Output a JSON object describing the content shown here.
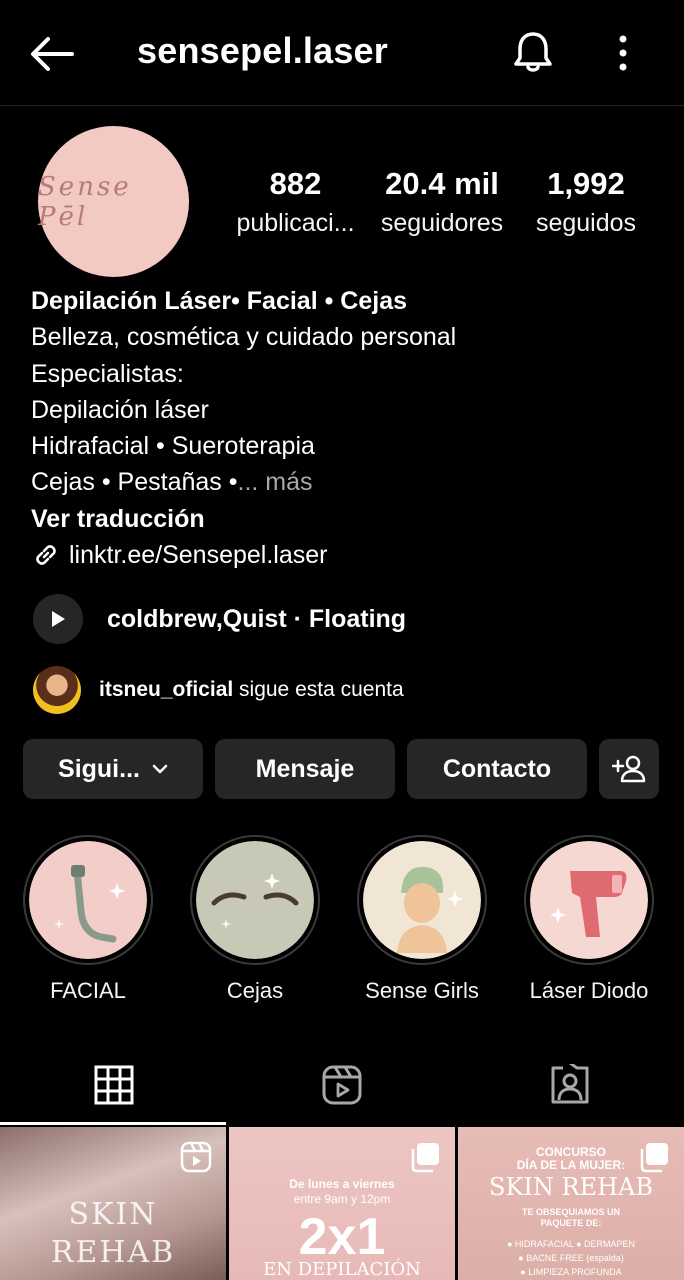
{
  "header": {
    "username": "sensepel.laser"
  },
  "profile": {
    "avatar_text": "Sense Pēl",
    "stats": [
      {
        "value": "882",
        "label": "publicaci..."
      },
      {
        "value": "20.4 mil",
        "label": "seguidores"
      },
      {
        "value": "1,992",
        "label": "seguidos"
      }
    ]
  },
  "bio": {
    "name": "Depilación Láser• Facial • Cejas",
    "category": "Belleza, cosmética y cuidado personal",
    "line1": "Especialistas:",
    "line2": "Depilación láser",
    "line3": "Hidrafacial • Sueroterapia",
    "line4": "Cejas • Pestañas •",
    "more": "... más",
    "translate": "Ver traducción",
    "link": "linktr.ee/Sensepel.laser"
  },
  "music": {
    "track": "coldbrew,Quist · Floating"
  },
  "followed_by": {
    "user": "itsneu_oficial",
    "text": " sigue esta cuenta"
  },
  "actions": {
    "follow": "Sigui...",
    "message": "Mensaje",
    "contact": "Contacto"
  },
  "highlights": [
    {
      "label": "FACIAL"
    },
    {
      "label": "Cejas"
    },
    {
      "label": "Sense Girls"
    },
    {
      "label": "Láser Diodo"
    }
  ],
  "posts": [
    {
      "line1": "SKIN",
      "line2": "REHAB"
    },
    {
      "line1": "De lunes a viernes",
      "line2": "entre 9am y 12pm",
      "big": "2x1",
      "line3": "EN DEPILACIÓN"
    },
    {
      "line1": "CONCURSO",
      "line2": "DÍA DE LA MUJER:",
      "big": "SKIN REHAB",
      "line3": "TE OBSEQUIAMOS UN",
      "line4": "PAQUETE DE:",
      "item1": "● HIDRAFACIAL  ● DERMAPEN",
      "item2": "● BACNE FREE (espalda)",
      "item3": "● LIMPIEZA PROFUNDA"
    }
  ],
  "colors": {
    "background": "#000000",
    "button": "#262626",
    "avatar_bg": "#f3c9c4"
  }
}
